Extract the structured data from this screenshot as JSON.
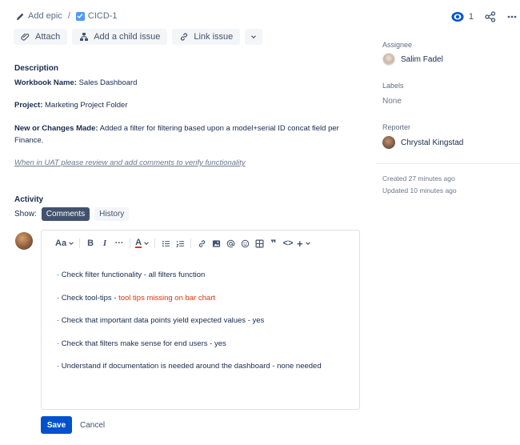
{
  "breadcrumb": {
    "add_epic": "Add epic",
    "separator": "/",
    "issue_key": "CICD-1"
  },
  "header_right": {
    "watch_count": "1",
    "share_icon": "share-icon",
    "more_icon": "more-icon"
  },
  "actions": {
    "attach": "Attach",
    "add_child": "Add a child issue",
    "link_issue": "Link issue"
  },
  "description": {
    "heading": "Description",
    "workbook_label": "Workbook Name:",
    "workbook_value": " Sales Dashboard",
    "project_label": "Project:",
    "project_value": " Marketing Project Folder",
    "changes_label": "New or Changes Made:",
    "changes_value": " Added a filter for filtering based upon a model+serial ID concat field per Finance.",
    "uat_note": "When in UAT please review and add comments to verify functionality"
  },
  "activity": {
    "heading": "Activity",
    "show_label": "Show:",
    "tabs": [
      "Comments",
      "History"
    ]
  },
  "editor": {
    "toolbar": {
      "text_style": "Aa",
      "bold": "B",
      "italic": "I",
      "more": "···",
      "text_color": "A",
      "quote": "❞",
      "code": "<>",
      "insert": "+"
    },
    "lines": [
      {
        "text": "· Check filter functionality - all filters function",
        "highlight": ""
      },
      {
        "text": "· Check tool-tips - ",
        "highlight": "tool tips missing on bar chart"
      },
      {
        "text": "· Check that important data points yield expected values - yes",
        "highlight": ""
      },
      {
        "text": "· Check that filters make sense for end users - yes",
        "highlight": ""
      },
      {
        "text": "· Understand if documentation is needed around the dashboard - none needed",
        "highlight": ""
      }
    ],
    "highlight_color": "#de350b"
  },
  "buttons": {
    "save": "Save",
    "cancel": "Cancel"
  },
  "sidebar": {
    "assignee_label": "Assignee",
    "assignee_name": "Salim Fadel",
    "labels_label": "Labels",
    "labels_value": "None",
    "reporter_label": "Reporter",
    "reporter_name": "Chrystal Kingstad",
    "created": "Created 27 minutes ago",
    "updated": "Updated 10 minutes ago"
  },
  "colors": {
    "primary": "#0052cc",
    "active_tab": "#42526e"
  }
}
